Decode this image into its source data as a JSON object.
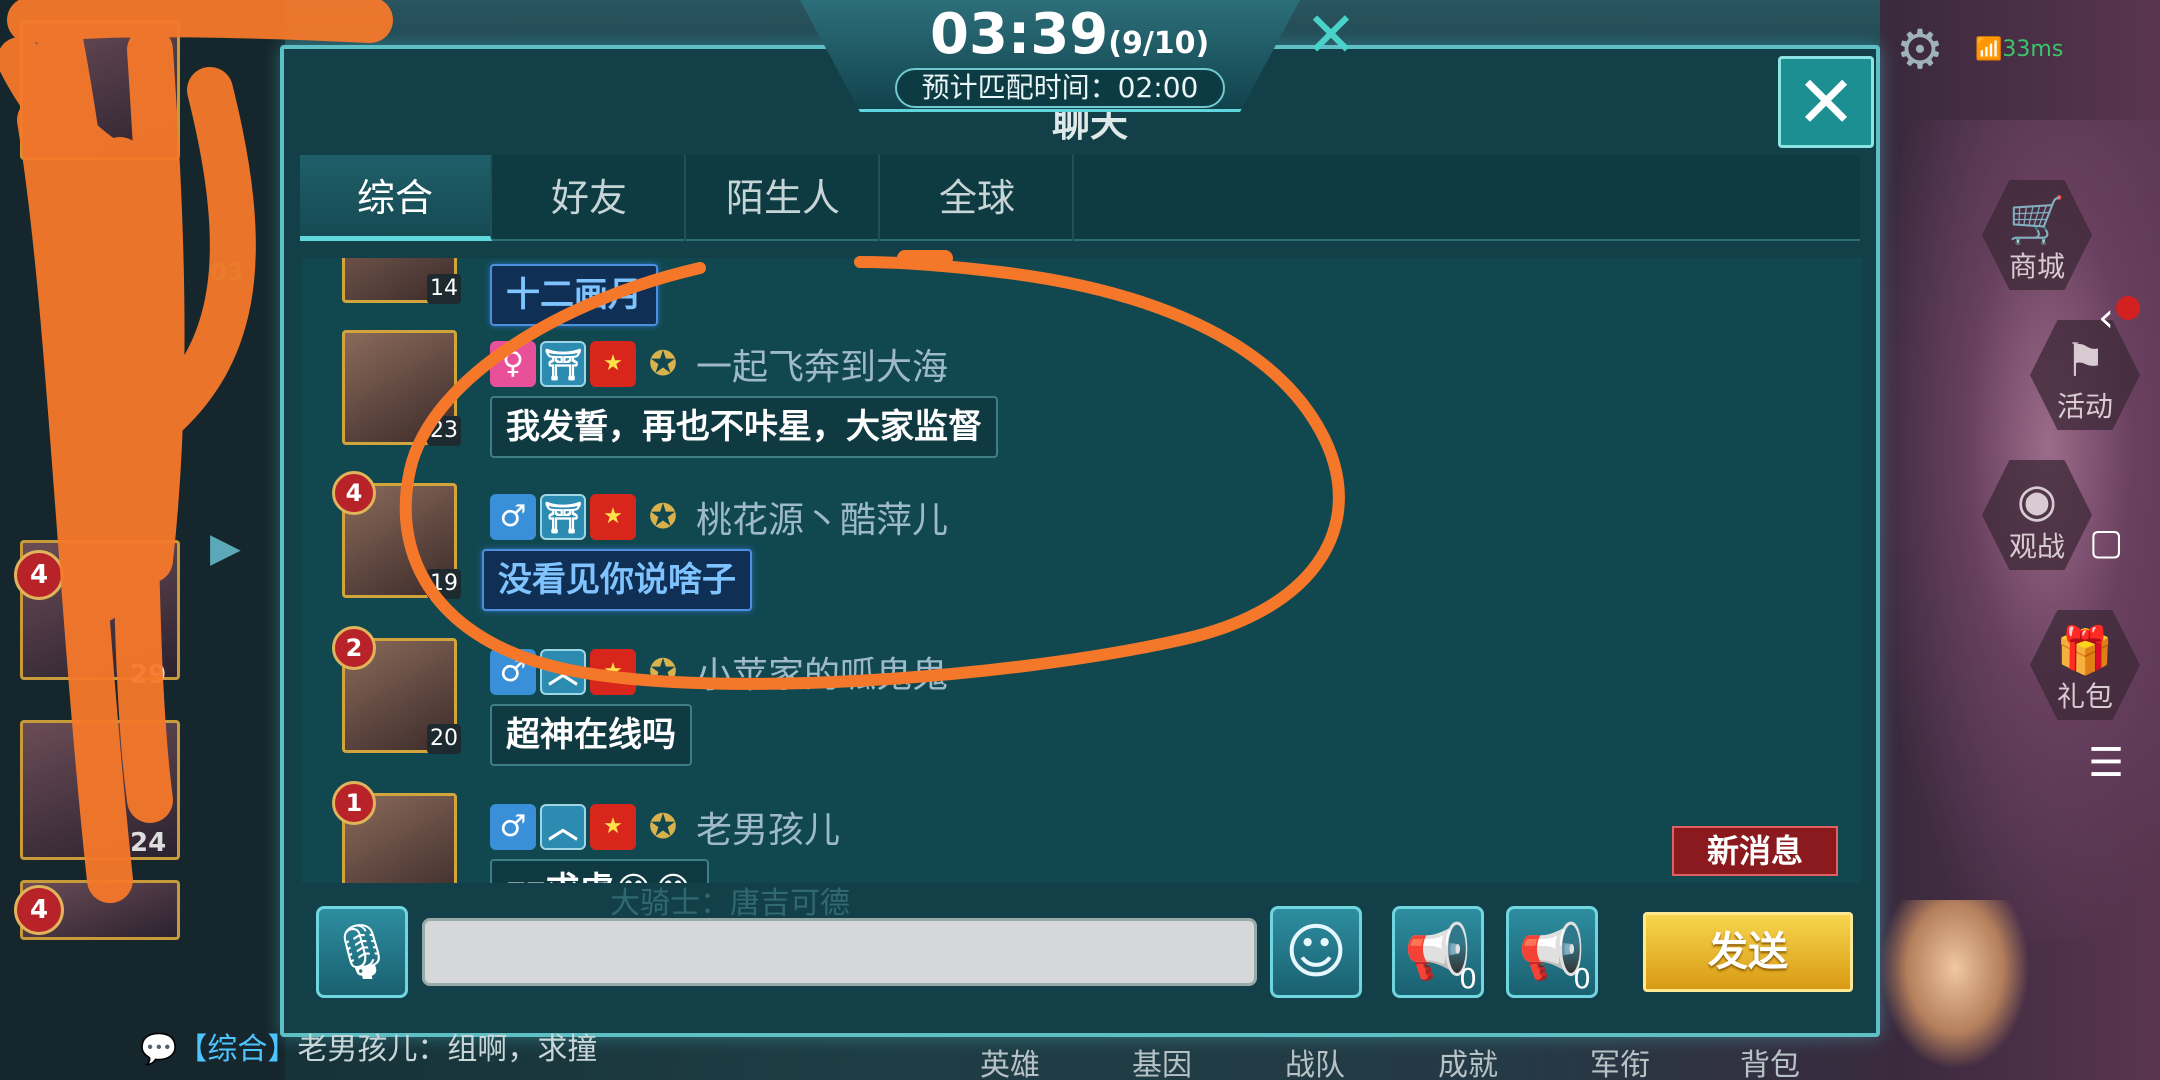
{
  "header": {
    "timer": "03:39",
    "players": "(9/10)",
    "eta_label": "预计匹配时间：",
    "eta_value": "02:00",
    "ping": "33ms"
  },
  "dialog": {
    "title": "聊天",
    "close_label": "✕"
  },
  "tabs": [
    {
      "label": "综合",
      "active": true
    },
    {
      "label": "好友",
      "active": false
    },
    {
      "label": "陌生人",
      "active": false
    },
    {
      "label": "全球",
      "active": false
    }
  ],
  "messages": [
    {
      "level": "14",
      "partial_text": "十二画月",
      "rank_badge": ""
    },
    {
      "level": "23",
      "gender": "female",
      "name": "一起飞奔到大海",
      "text": "我发誓，再也不咔星，大家监督",
      "rank_badge": "",
      "style": "normal"
    },
    {
      "level": "19",
      "gender": "male",
      "name": "桃花源丶酷萍儿",
      "text": "没看见你说啥子",
      "rank_badge": "4",
      "style": "blue"
    },
    {
      "level": "20",
      "gender": "male",
      "name": "小苹家的呱鬼鬼",
      "text": "超神在线吗",
      "rank_badge": "2",
      "style": "normal"
    },
    {
      "level": "",
      "gender": "male",
      "name": "老男孩儿",
      "text": "zz求虐😂😂",
      "rank_badge": "1",
      "style": "normal"
    }
  ],
  "new_message_label": "新消息",
  "input": {
    "placeholder": "",
    "horn_gold_count": "0",
    "horn_blue_count": "0",
    "send_label": "发送"
  },
  "side_menu": [
    {
      "icon": "cart-icon",
      "label": "商城"
    },
    {
      "icon": "flag-icon",
      "label": "活动"
    },
    {
      "icon": "eye-icon",
      "label": "观战"
    },
    {
      "icon": "gift-icon",
      "label": "礼包"
    }
  ],
  "left_panel": {
    "cards": [
      {
        "badge": "4",
        "level": ""
      },
      {
        "badge": "4",
        "level": "29"
      },
      {
        "badge": "",
        "level": "24"
      },
      {
        "badge": "4",
        "level": ""
      }
    ],
    "timer_fragment": "03"
  },
  "bottom_nav": [
    "英雄",
    "基因",
    "战队",
    "成就",
    "军衔",
    "背包"
  ],
  "bottom_chat": {
    "channel": "【综合】",
    "text": "老男孩儿：组啊，求撞"
  },
  "overlay_caption": "大骑士：唐吉可德",
  "colors": {
    "accent": "#5fd8de",
    "annotation": "#f5782a",
    "send": "#f2c535",
    "new_message": "#8a1a1e"
  }
}
